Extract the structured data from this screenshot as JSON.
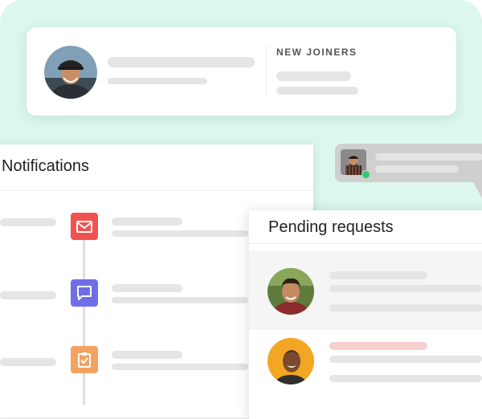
{
  "new_joiners": {
    "label": "NEW JOINERS"
  },
  "notifications": {
    "title": "Notifications",
    "items": [
      {
        "icon": "mail-icon",
        "color": "#ef5350"
      },
      {
        "icon": "chat-icon",
        "color": "#6e6ee8"
      },
      {
        "icon": "clipboard-check-icon",
        "color": "#f4a261"
      }
    ]
  },
  "pending": {
    "title": "Pending requests"
  },
  "colors": {
    "mint_background": "#dcf8ec",
    "online": "#2ecc71",
    "skeleton": "#e5e5e5",
    "skeleton_highlight": "#f6cfcf"
  }
}
